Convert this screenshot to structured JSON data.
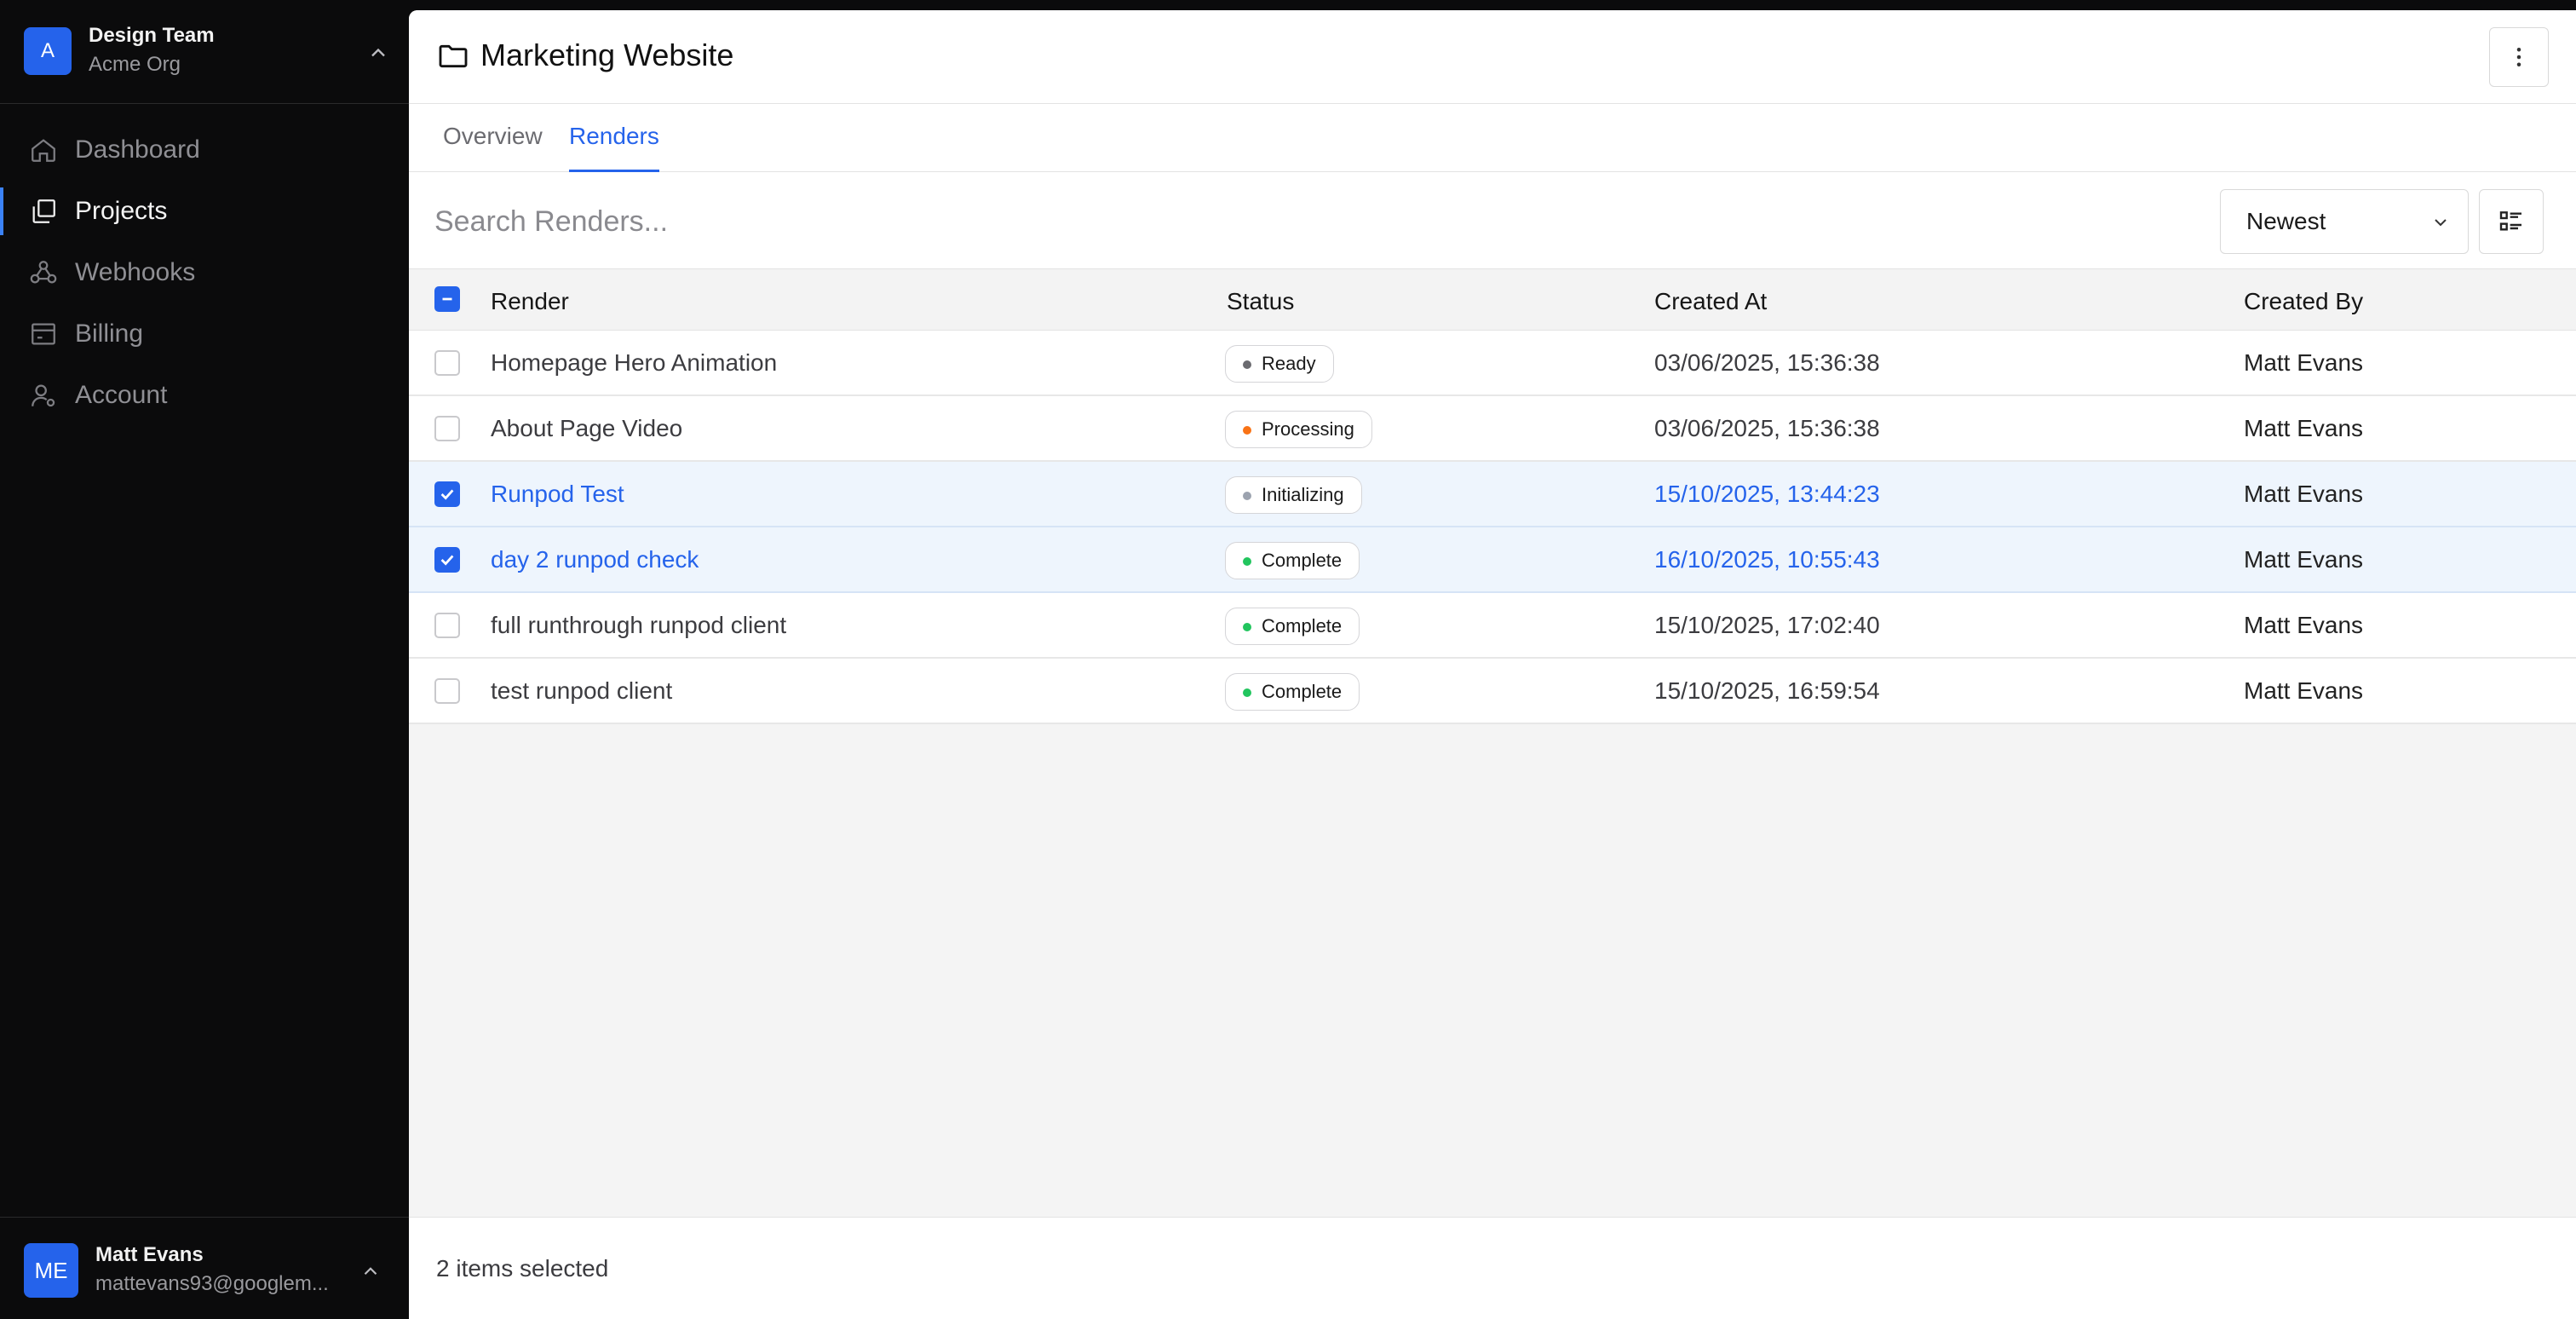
{
  "team": {
    "avatar": "A",
    "name": "Design Team",
    "org": "Acme Org"
  },
  "nav": [
    {
      "label": "Dashboard",
      "icon": "home-icon",
      "active": false
    },
    {
      "label": "Projects",
      "icon": "projects-icon",
      "active": true
    },
    {
      "label": "Webhooks",
      "icon": "webhook-icon",
      "active": false
    },
    {
      "label": "Billing",
      "icon": "billing-icon",
      "active": false
    },
    {
      "label": "Account",
      "icon": "user-icon",
      "active": false
    }
  ],
  "user": {
    "initials": "ME",
    "name": "Matt Evans",
    "email": "mattevans93@googlem..."
  },
  "header": {
    "title": "Marketing Website"
  },
  "tabs": [
    {
      "label": "Overview",
      "active": false
    },
    {
      "label": "Renders",
      "active": true
    }
  ],
  "toolbar": {
    "search_placeholder": "Search Renders...",
    "search_value": "",
    "sort_value": "Newest"
  },
  "table": {
    "columns": [
      "Render",
      "Status",
      "Created At",
      "Created By"
    ],
    "rows": [
      {
        "render": "Homepage Hero Animation",
        "status": "Ready",
        "created_at": "03/06/2025, 15:36:38",
        "created_by": "Matt Evans",
        "selected": false
      },
      {
        "render": "About Page Video",
        "status": "Processing",
        "created_at": "03/06/2025, 15:36:38",
        "created_by": "Matt Evans",
        "selected": false
      },
      {
        "render": "Runpod Test",
        "status": "Initializing",
        "created_at": "15/10/2025, 13:44:23",
        "created_by": "Matt Evans",
        "selected": true
      },
      {
        "render": "day 2 runpod check",
        "status": "Complete",
        "created_at": "16/10/2025, 10:55:43",
        "created_by": "Matt Evans",
        "selected": true
      },
      {
        "render": "full runthrough runpod client",
        "status": "Complete",
        "created_at": "15/10/2025, 17:02:40",
        "created_by": "Matt Evans",
        "selected": false
      },
      {
        "render": "test runpod client",
        "status": "Complete",
        "created_at": "15/10/2025, 16:59:54",
        "created_by": "Matt Evans",
        "selected": false
      }
    ]
  },
  "status_colors": {
    "Ready": "#6b6b70",
    "Processing": "#f97316",
    "Initializing": "#9ca3af",
    "Complete": "#22c55e"
  },
  "accent": "#2563eb",
  "footer": {
    "selection_text": "2 items selected"
  }
}
